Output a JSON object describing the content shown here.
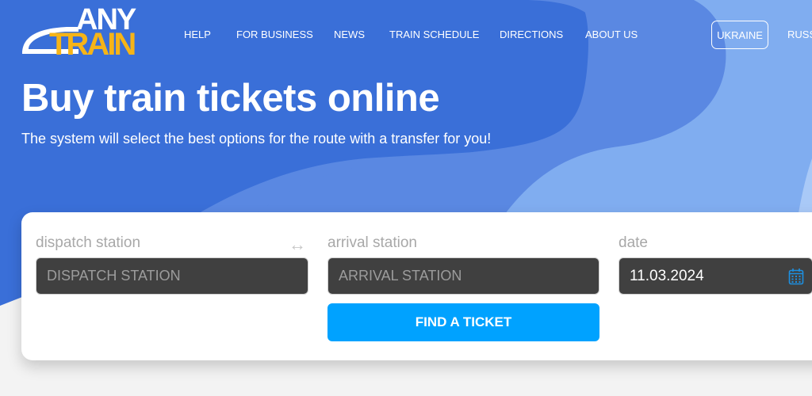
{
  "logo": {
    "line1": "ANY",
    "line2": "TRAIN"
  },
  "nav": {
    "items": [
      {
        "label": "HELP"
      },
      {
        "label": "FOR BUSINESS"
      },
      {
        "label": "NEWS"
      },
      {
        "label": "TRAIN SCHEDULE"
      },
      {
        "label": "DIRECTIONS"
      },
      {
        "label": "ABOUT US"
      }
    ],
    "languages": [
      {
        "label": "UKRAINE",
        "active": true
      },
      {
        "label": "RUSS"
      }
    ]
  },
  "hero": {
    "title": "Buy train tickets online",
    "subtitle": "The system will select the best options for the route with a transfer for you!"
  },
  "search": {
    "dispatch": {
      "label": "dispatch station",
      "placeholder": "DISPATCH STATION",
      "value": ""
    },
    "swap_icon": "swap-arrows-icon",
    "arrival": {
      "label": "arrival station",
      "placeholder": "ARRIVAL STATION",
      "value": ""
    },
    "date": {
      "label": "date",
      "value": "11.03.2024",
      "icon": "calendar-icon"
    },
    "submit_label": "FIND A TICKET"
  },
  "colors": {
    "hero_blue": "#3a6fd8",
    "mid_blue": "#5a88e2",
    "light_blue": "#80adf0",
    "logo_yellow": "#f6b417",
    "button_blue": "#00a2ff",
    "input_dark": "#404040"
  }
}
